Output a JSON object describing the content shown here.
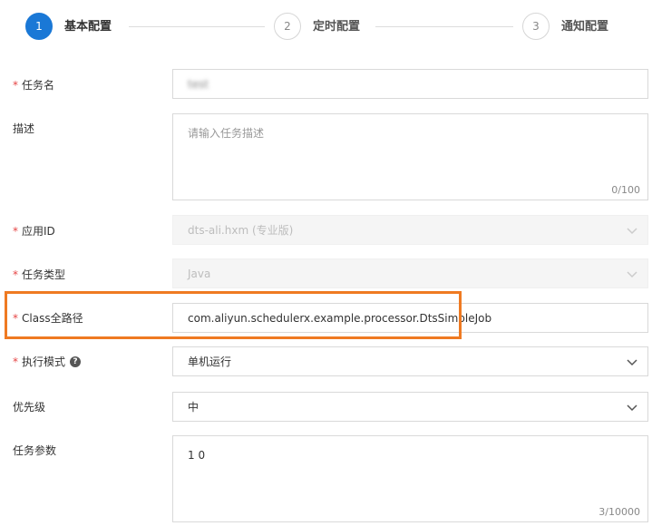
{
  "steps": [
    {
      "number": "1",
      "label": "基本配置",
      "state": "active"
    },
    {
      "number": "2",
      "label": "定时配置",
      "state": "inactive"
    },
    {
      "number": "3",
      "label": "通知配置",
      "state": "inactive"
    }
  ],
  "form": {
    "required_mark": "*",
    "task_name": {
      "label": "任务名",
      "value": "test"
    },
    "description": {
      "label": "描述",
      "placeholder": "请输入任务描述",
      "counter": "0/100"
    },
    "app_id": {
      "label": "应用ID",
      "value": "dts-ali.hxm (专业版)"
    },
    "task_type": {
      "label": "任务类型",
      "value": "Java"
    },
    "class_path": {
      "label": "Class全路径",
      "value": "com.aliyun.schedulerx.example.processor.DtsSimpleJob"
    },
    "exec_mode": {
      "label": "执行模式",
      "help": "?",
      "value": "单机运行"
    },
    "priority": {
      "label": "优先级",
      "value": "中"
    },
    "task_params": {
      "label": "任务参数",
      "value": "1 0",
      "counter": "3/10000"
    }
  },
  "colors": {
    "accent": "#1a78d6",
    "required": "#e64545",
    "highlight": "#ef7a22"
  },
  "icons": {
    "dropdown": "chevron-down-icon",
    "help": "question-circle-icon"
  }
}
